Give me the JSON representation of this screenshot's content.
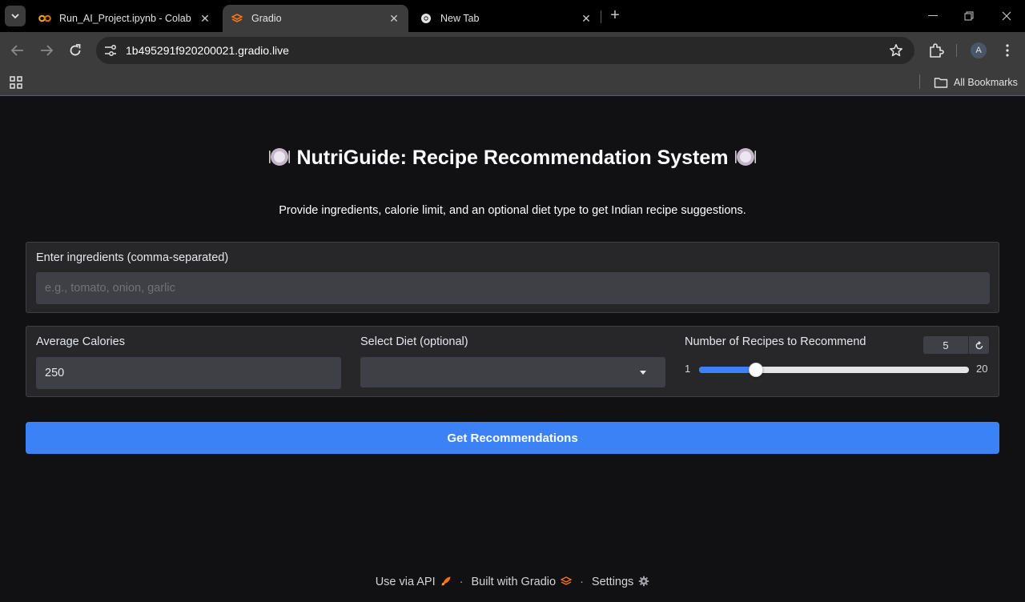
{
  "browser": {
    "tabs": [
      {
        "title": "Run_AI_Project.ipynb - Colab",
        "icon": "colab-icon",
        "active": false
      },
      {
        "title": "Gradio",
        "icon": "gradio-icon",
        "active": true
      },
      {
        "title": "New Tab",
        "icon": "chrome-icon",
        "active": false
      }
    ],
    "url": "1b495291f920200021.gradio.live",
    "profile_initial": "A",
    "bookmarks_label": "All Bookmarks"
  },
  "app": {
    "title": "NutriGuide: Recipe Recommendation System",
    "subtitle": "Provide ingredients, calorie limit, and an optional diet type to get Indian recipe suggestions.",
    "ingredients": {
      "label": "Enter ingredients (comma-separated)",
      "placeholder": "e.g., tomato, onion, garlic",
      "value": ""
    },
    "calories": {
      "label": "Average Calories",
      "value": "250"
    },
    "diet": {
      "label": "Select Diet (optional)",
      "value": ""
    },
    "recipes": {
      "label": "Number of Recipes to Recommend",
      "value": 5,
      "min": 1,
      "max": 20
    },
    "submit_label": "Get Recommendations",
    "footer": {
      "api": "Use via API",
      "built": "Built with Gradio",
      "settings": "Settings"
    }
  },
  "colors": {
    "accent": "#3b82f6",
    "panel": "#27272a",
    "page_bg": "#111114"
  }
}
